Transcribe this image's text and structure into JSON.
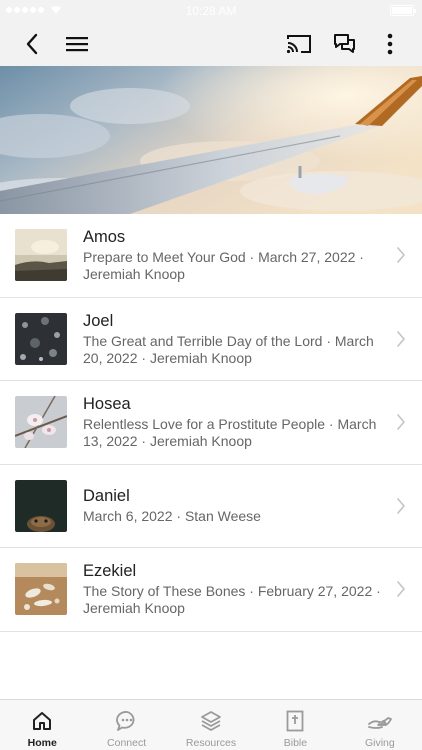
{
  "status_bar": {
    "time": "10:28 AM"
  },
  "sermons": [
    {
      "title": "Amos",
      "subtitle": "Prepare to Meet Your God · March 27, 2022 · Jeremiah Knoop"
    },
    {
      "title": "Joel",
      "subtitle": "The Great and Terrible Day of the Lord · March 20, 2022 · Jeremiah Knoop"
    },
    {
      "title": "Hosea",
      "subtitle": "Relentless Love for a Prostitute People · March 13, 2022 · Jeremiah Knoop"
    },
    {
      "title": "Daniel",
      "subtitle": "March 6, 2022 · Stan Weese"
    },
    {
      "title": "Ezekiel",
      "subtitle": "The Story of These Bones · February 27, 2022 · Jeremiah Knoop"
    }
  ],
  "tabs": [
    {
      "label": "Home",
      "icon": "home-icon",
      "active": true
    },
    {
      "label": "Connect",
      "icon": "chat-bubble-icon",
      "active": false
    },
    {
      "label": "Resources",
      "icon": "layers-icon",
      "active": false
    },
    {
      "label": "Bible",
      "icon": "bible-icon",
      "active": false
    },
    {
      "label": "Giving",
      "icon": "giving-hand-icon",
      "active": false
    }
  ],
  "colors": {
    "nav_background": "#f2f2f2",
    "accent_active": "#222222",
    "inactive": "#9a9a9a"
  }
}
